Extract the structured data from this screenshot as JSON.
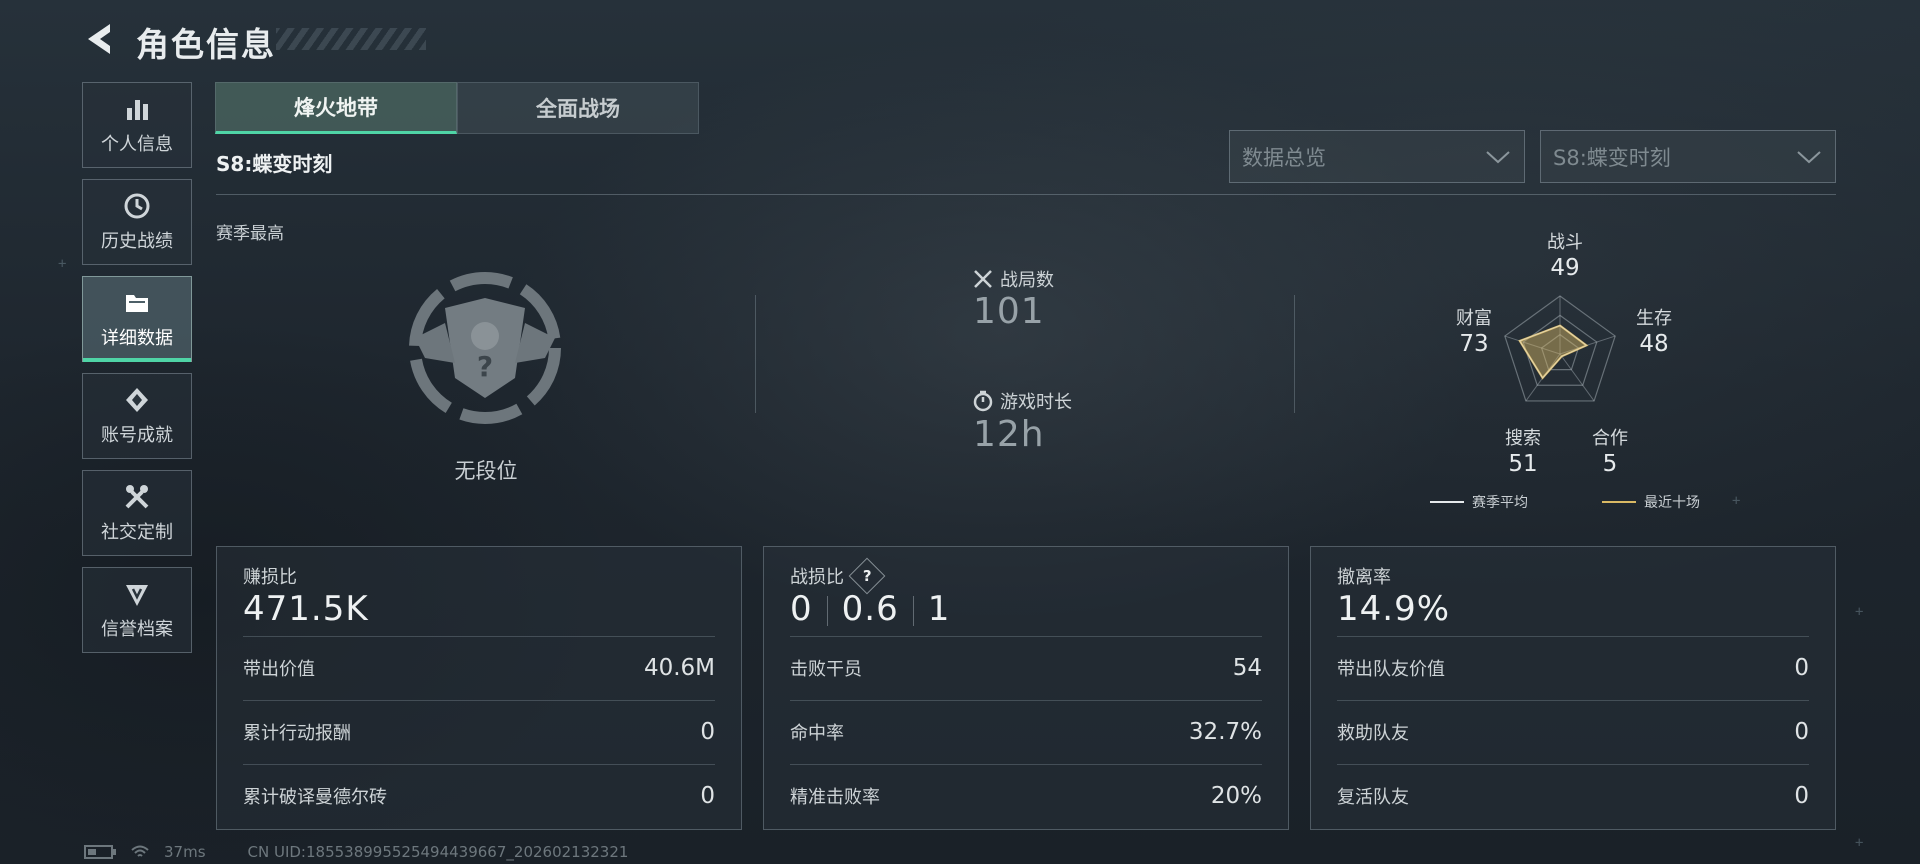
{
  "header": {
    "title": "角色信息"
  },
  "sidebar": {
    "items": [
      {
        "label": "个人信息",
        "icon": "bar-chart-icon",
        "active": false
      },
      {
        "label": "历史战绩",
        "icon": "history-icon",
        "active": false
      },
      {
        "label": "详细数据",
        "icon": "folder-icon",
        "active": true
      },
      {
        "label": "账号成就",
        "icon": "achievement-icon",
        "active": false
      },
      {
        "label": "社交定制",
        "icon": "tools-icon",
        "active": false
      },
      {
        "label": "信誉档案",
        "icon": "credit-icon",
        "active": false
      }
    ]
  },
  "tabs": [
    {
      "label": "烽火地带",
      "active": true
    },
    {
      "label": "全面战场",
      "active": false
    }
  ],
  "season_title": "S8:蝶变时刻",
  "filters": {
    "data_type": {
      "value": "数据总览"
    },
    "season": {
      "value": "S8:蝶变时刻"
    }
  },
  "overview": {
    "season_best_label": "赛季最高",
    "rank_text": "无段位",
    "matches": {
      "label": "战局数",
      "value": "101"
    },
    "playtime": {
      "label": "游戏时长",
      "value": "12h"
    }
  },
  "radar": {
    "axes": [
      {
        "label": "战斗",
        "value": "49"
      },
      {
        "label": "生存",
        "value": "48"
      },
      {
        "label": "合作",
        "value": "5"
      },
      {
        "label": "搜索",
        "value": "51"
      },
      {
        "label": "财富",
        "value": "73"
      }
    ],
    "legend": {
      "season_avg": "赛季平均",
      "recent_ten": "最近十场"
    },
    "colors": {
      "season_avg": "#e6eaec",
      "recent_ten": "#d9b964"
    }
  },
  "cards": [
    {
      "title": "赚损比",
      "big": "471.5K",
      "rows": [
        {
          "k": "带出价值",
          "v": "40.6M"
        },
        {
          "k": "累计行动报酬",
          "v": "0"
        },
        {
          "k": "累计破译曼德尔砖",
          "v": "0"
        }
      ]
    },
    {
      "title": "战损比",
      "help": "?",
      "big_parts": [
        "0",
        "0.6",
        "1"
      ],
      "rows": [
        {
          "k": "击败干员",
          "v": "54"
        },
        {
          "k": "命中率",
          "v": "32.7%"
        },
        {
          "k": "精准击败率",
          "v": "20%"
        }
      ]
    },
    {
      "title": "撤离率",
      "big": "14.9%",
      "rows": [
        {
          "k": "带出队友价值",
          "v": "0"
        },
        {
          "k": "救助队友",
          "v": "0"
        },
        {
          "k": "复活队友",
          "v": "0"
        }
      ]
    }
  ],
  "footer": {
    "ping": "37ms",
    "uid": "CN UID:18553899552549443966​7_202602132321"
  },
  "accent_color": "#4fd4a6"
}
